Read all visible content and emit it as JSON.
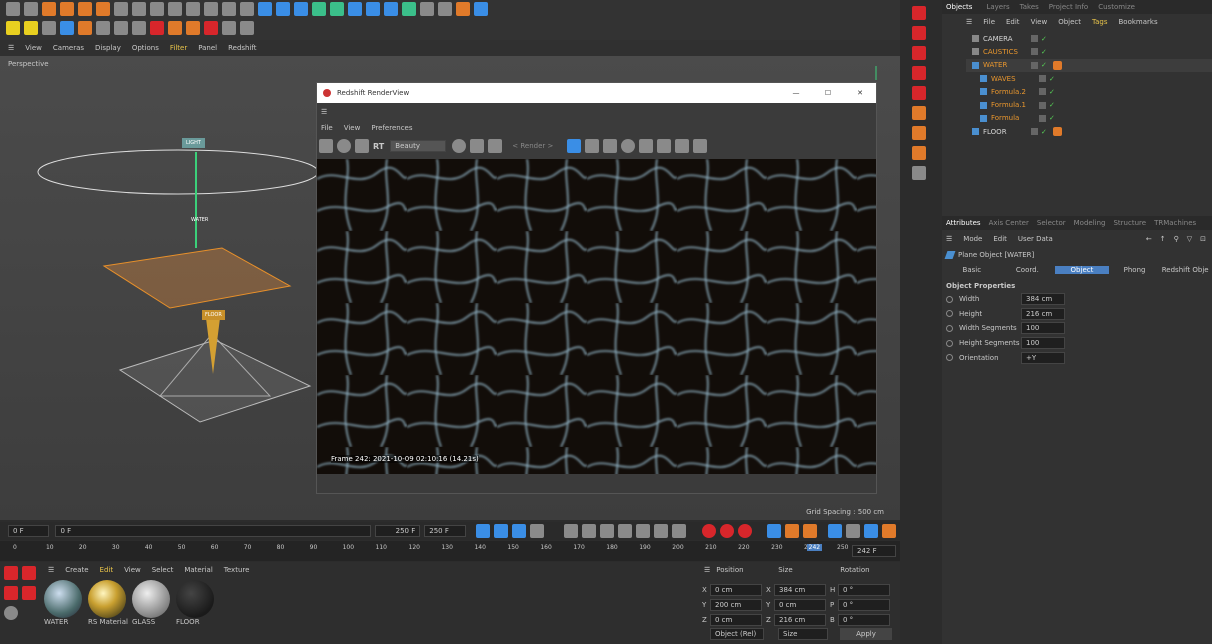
{
  "viewport_menu": [
    "View",
    "Cameras",
    "Display",
    "Options",
    "Filter",
    "Panel",
    "Redshift"
  ],
  "viewport": {
    "label": "Perspective",
    "grid_spacing": "Grid Spacing : 500 cm",
    "tag_light": "LIGHT",
    "tag_water": "WATER",
    "tag_floor": "FLOOR"
  },
  "renderview": {
    "title": "Redshift RenderView",
    "menu": [
      "File",
      "View",
      "Preferences"
    ],
    "rt": "RT",
    "aov": "Beauty",
    "render_sel": "< Render >",
    "frame_info": "Frame  242:  2021-10-09  02:10:16  (14.21s)",
    "ctrl": [
      "—",
      "☐",
      "✕"
    ]
  },
  "timeline": {
    "start": "0 F",
    "field2": "0 F",
    "end1": "250 F",
    "end2": "250 F",
    "ticks": [
      "0",
      "10",
      "20",
      "30",
      "40",
      "50",
      "60",
      "70",
      "80",
      "90",
      "100",
      "110",
      "120",
      "130",
      "140",
      "150",
      "160",
      "170",
      "180",
      "190",
      "200",
      "210",
      "220",
      "230",
      "240",
      "250"
    ],
    "current": "242",
    "current_field": "242 F",
    "progress": 0.968
  },
  "materials": {
    "menu": [
      "Create",
      "Edit",
      "View",
      "Select",
      "Material",
      "Texture"
    ],
    "items": [
      "WATER",
      "RS Material",
      "GLASS",
      "FLOOR"
    ]
  },
  "coords": {
    "headers": [
      "Position",
      "Size",
      "Rotation"
    ],
    "rows": [
      [
        "X",
        "0 cm",
        "X",
        "384 cm",
        "H",
        "0 °"
      ],
      [
        "Y",
        "200 cm",
        "Y",
        "0 cm",
        "P",
        "0 °"
      ],
      [
        "Z",
        "0 cm",
        "Z",
        "216 cm",
        "B",
        "0 °"
      ]
    ],
    "mode": "Object (Rel)",
    "size_mode": "Size",
    "apply": "Apply"
  },
  "objects": {
    "tabs": [
      "Objects",
      "Layers",
      "Takes",
      "Project Info",
      "Customize"
    ],
    "menu": [
      "File",
      "Edit",
      "View",
      "Object",
      "Tags",
      "Bookmarks"
    ],
    "items": [
      {
        "name": "CAMERA",
        "indent": 0,
        "color": "#d6d6d6"
      },
      {
        "name": "CAUSTICS",
        "indent": 0,
        "color": "#e8962e"
      },
      {
        "name": "WATER",
        "indent": 0,
        "color": "#e8962e"
      },
      {
        "name": "WAVES",
        "indent": 1,
        "color": "#e8962e"
      },
      {
        "name": "Formula.2",
        "indent": 1,
        "color": "#e8962e"
      },
      {
        "name": "Formula.1",
        "indent": 1,
        "color": "#e8962e"
      },
      {
        "name": "Formula",
        "indent": 1,
        "color": "#e8962e"
      },
      {
        "name": "FLOOR",
        "indent": 0,
        "color": "#d6d6d6"
      }
    ]
  },
  "attributes": {
    "tabs": [
      "Attributes",
      "Axis Center",
      "Selector",
      "Modeling",
      "Structure",
      "TRMachines"
    ],
    "menu": [
      "Mode",
      "Edit",
      "User Data"
    ],
    "object_title": "Plane Object [WATER]",
    "subtabs": [
      "Basic",
      "Coord.",
      "Object",
      "Phong",
      "Redshift Obje"
    ],
    "section": "Object Properties",
    "props": [
      [
        "Width",
        "384 cm"
      ],
      [
        "Height",
        "216 cm"
      ],
      [
        "Width Segments",
        "100"
      ],
      [
        "Height Segments",
        "100"
      ],
      [
        "Orientation",
        "+Y"
      ]
    ]
  },
  "colors": {
    "accent": "#4a7fc1",
    "orange": "#e8962e",
    "red": "#d8262b"
  }
}
